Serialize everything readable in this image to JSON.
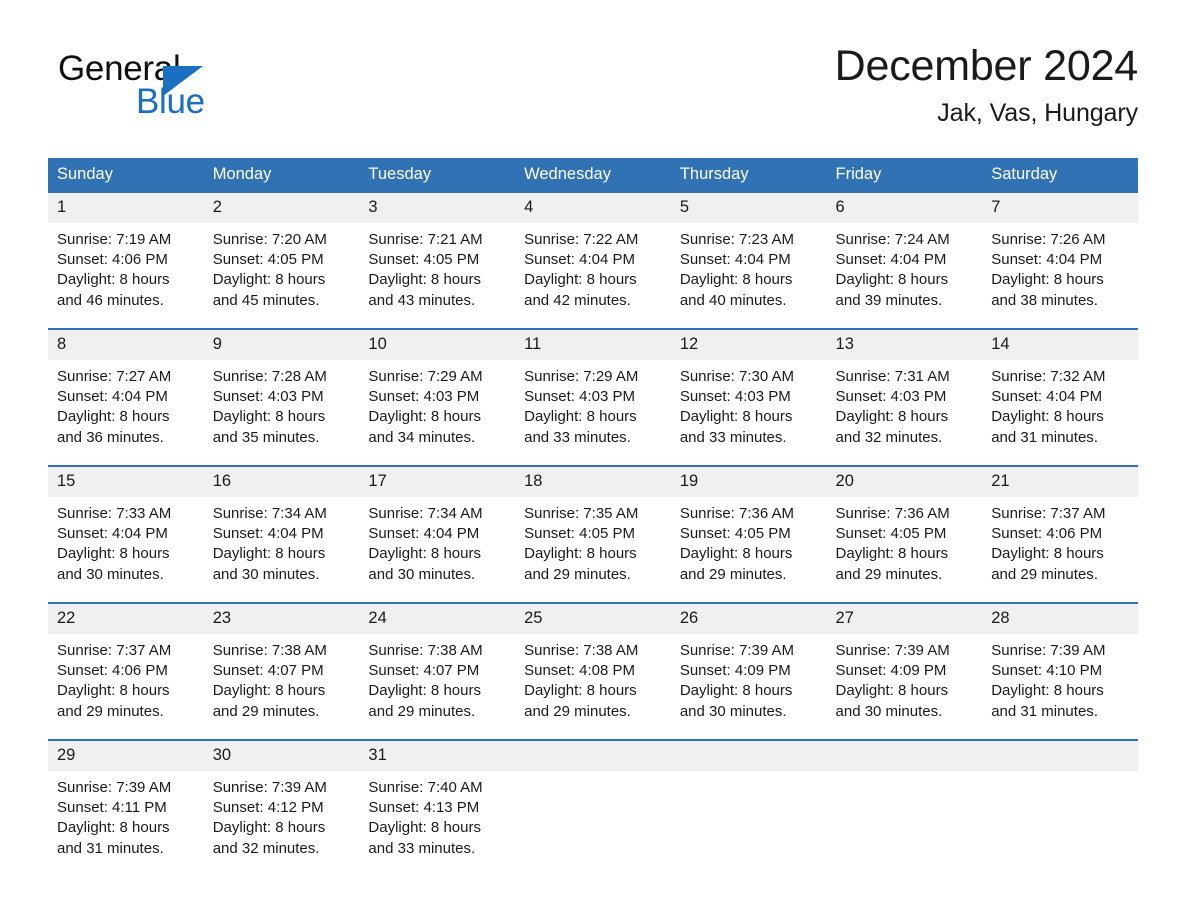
{
  "brand": {
    "name_part1": "General",
    "name_part2": "Blue"
  },
  "header": {
    "title": "December 2024",
    "location": "Jak, Vas, Hungary"
  },
  "colors": {
    "header_blue": "#3072b3",
    "brand_blue": "#1a6fc0",
    "daynum_bg": "#f0f0f0",
    "week_separator": "#3072b3"
  },
  "weekday_headers": [
    "Sunday",
    "Monday",
    "Tuesday",
    "Wednesday",
    "Thursday",
    "Friday",
    "Saturday"
  ],
  "weeks": [
    [
      {
        "day": "1",
        "sunrise": "Sunrise: 7:19 AM",
        "sunset": "Sunset: 4:06 PM",
        "daylight1": "Daylight: 8 hours",
        "daylight2": "and 46 minutes."
      },
      {
        "day": "2",
        "sunrise": "Sunrise: 7:20 AM",
        "sunset": "Sunset: 4:05 PM",
        "daylight1": "Daylight: 8 hours",
        "daylight2": "and 45 minutes."
      },
      {
        "day": "3",
        "sunrise": "Sunrise: 7:21 AM",
        "sunset": "Sunset: 4:05 PM",
        "daylight1": "Daylight: 8 hours",
        "daylight2": "and 43 minutes."
      },
      {
        "day": "4",
        "sunrise": "Sunrise: 7:22 AM",
        "sunset": "Sunset: 4:04 PM",
        "daylight1": "Daylight: 8 hours",
        "daylight2": "and 42 minutes."
      },
      {
        "day": "5",
        "sunrise": "Sunrise: 7:23 AM",
        "sunset": "Sunset: 4:04 PM",
        "daylight1": "Daylight: 8 hours",
        "daylight2": "and 40 minutes."
      },
      {
        "day": "6",
        "sunrise": "Sunrise: 7:24 AM",
        "sunset": "Sunset: 4:04 PM",
        "daylight1": "Daylight: 8 hours",
        "daylight2": "and 39 minutes."
      },
      {
        "day": "7",
        "sunrise": "Sunrise: 7:26 AM",
        "sunset": "Sunset: 4:04 PM",
        "daylight1": "Daylight: 8 hours",
        "daylight2": "and 38 minutes."
      }
    ],
    [
      {
        "day": "8",
        "sunrise": "Sunrise: 7:27 AM",
        "sunset": "Sunset: 4:04 PM",
        "daylight1": "Daylight: 8 hours",
        "daylight2": "and 36 minutes."
      },
      {
        "day": "9",
        "sunrise": "Sunrise: 7:28 AM",
        "sunset": "Sunset: 4:03 PM",
        "daylight1": "Daylight: 8 hours",
        "daylight2": "and 35 minutes."
      },
      {
        "day": "10",
        "sunrise": "Sunrise: 7:29 AM",
        "sunset": "Sunset: 4:03 PM",
        "daylight1": "Daylight: 8 hours",
        "daylight2": "and 34 minutes."
      },
      {
        "day": "11",
        "sunrise": "Sunrise: 7:29 AM",
        "sunset": "Sunset: 4:03 PM",
        "daylight1": "Daylight: 8 hours",
        "daylight2": "and 33 minutes."
      },
      {
        "day": "12",
        "sunrise": "Sunrise: 7:30 AM",
        "sunset": "Sunset: 4:03 PM",
        "daylight1": "Daylight: 8 hours",
        "daylight2": "and 33 minutes."
      },
      {
        "day": "13",
        "sunrise": "Sunrise: 7:31 AM",
        "sunset": "Sunset: 4:03 PM",
        "daylight1": "Daylight: 8 hours",
        "daylight2": "and 32 minutes."
      },
      {
        "day": "14",
        "sunrise": "Sunrise: 7:32 AM",
        "sunset": "Sunset: 4:04 PM",
        "daylight1": "Daylight: 8 hours",
        "daylight2": "and 31 minutes."
      }
    ],
    [
      {
        "day": "15",
        "sunrise": "Sunrise: 7:33 AM",
        "sunset": "Sunset: 4:04 PM",
        "daylight1": "Daylight: 8 hours",
        "daylight2": "and 30 minutes."
      },
      {
        "day": "16",
        "sunrise": "Sunrise: 7:34 AM",
        "sunset": "Sunset: 4:04 PM",
        "daylight1": "Daylight: 8 hours",
        "daylight2": "and 30 minutes."
      },
      {
        "day": "17",
        "sunrise": "Sunrise: 7:34 AM",
        "sunset": "Sunset: 4:04 PM",
        "daylight1": "Daylight: 8 hours",
        "daylight2": "and 30 minutes."
      },
      {
        "day": "18",
        "sunrise": "Sunrise: 7:35 AM",
        "sunset": "Sunset: 4:05 PM",
        "daylight1": "Daylight: 8 hours",
        "daylight2": "and 29 minutes."
      },
      {
        "day": "19",
        "sunrise": "Sunrise: 7:36 AM",
        "sunset": "Sunset: 4:05 PM",
        "daylight1": "Daylight: 8 hours",
        "daylight2": "and 29 minutes."
      },
      {
        "day": "20",
        "sunrise": "Sunrise: 7:36 AM",
        "sunset": "Sunset: 4:05 PM",
        "daylight1": "Daylight: 8 hours",
        "daylight2": "and 29 minutes."
      },
      {
        "day": "21",
        "sunrise": "Sunrise: 7:37 AM",
        "sunset": "Sunset: 4:06 PM",
        "daylight1": "Daylight: 8 hours",
        "daylight2": "and 29 minutes."
      }
    ],
    [
      {
        "day": "22",
        "sunrise": "Sunrise: 7:37 AM",
        "sunset": "Sunset: 4:06 PM",
        "daylight1": "Daylight: 8 hours",
        "daylight2": "and 29 minutes."
      },
      {
        "day": "23",
        "sunrise": "Sunrise: 7:38 AM",
        "sunset": "Sunset: 4:07 PM",
        "daylight1": "Daylight: 8 hours",
        "daylight2": "and 29 minutes."
      },
      {
        "day": "24",
        "sunrise": "Sunrise: 7:38 AM",
        "sunset": "Sunset: 4:07 PM",
        "daylight1": "Daylight: 8 hours",
        "daylight2": "and 29 minutes."
      },
      {
        "day": "25",
        "sunrise": "Sunrise: 7:38 AM",
        "sunset": "Sunset: 4:08 PM",
        "daylight1": "Daylight: 8 hours",
        "daylight2": "and 29 minutes."
      },
      {
        "day": "26",
        "sunrise": "Sunrise: 7:39 AM",
        "sunset": "Sunset: 4:09 PM",
        "daylight1": "Daylight: 8 hours",
        "daylight2": "and 30 minutes."
      },
      {
        "day": "27",
        "sunrise": "Sunrise: 7:39 AM",
        "sunset": "Sunset: 4:09 PM",
        "daylight1": "Daylight: 8 hours",
        "daylight2": "and 30 minutes."
      },
      {
        "day": "28",
        "sunrise": "Sunrise: 7:39 AM",
        "sunset": "Sunset: 4:10 PM",
        "daylight1": "Daylight: 8 hours",
        "daylight2": "and 31 minutes."
      }
    ],
    [
      {
        "day": "29",
        "sunrise": "Sunrise: 7:39 AM",
        "sunset": "Sunset: 4:11 PM",
        "daylight1": "Daylight: 8 hours",
        "daylight2": "and 31 minutes."
      },
      {
        "day": "30",
        "sunrise": "Sunrise: 7:39 AM",
        "sunset": "Sunset: 4:12 PM",
        "daylight1": "Daylight: 8 hours",
        "daylight2": "and 32 minutes."
      },
      {
        "day": "31",
        "sunrise": "Sunrise: 7:40 AM",
        "sunset": "Sunset: 4:13 PM",
        "daylight1": "Daylight: 8 hours",
        "daylight2": "and 33 minutes."
      },
      {
        "day": "",
        "sunrise": "",
        "sunset": "",
        "daylight1": "",
        "daylight2": ""
      },
      {
        "day": "",
        "sunrise": "",
        "sunset": "",
        "daylight1": "",
        "daylight2": ""
      },
      {
        "day": "",
        "sunrise": "",
        "sunset": "",
        "daylight1": "",
        "daylight2": ""
      },
      {
        "day": "",
        "sunrise": "",
        "sunset": "",
        "daylight1": "",
        "daylight2": ""
      }
    ]
  ]
}
